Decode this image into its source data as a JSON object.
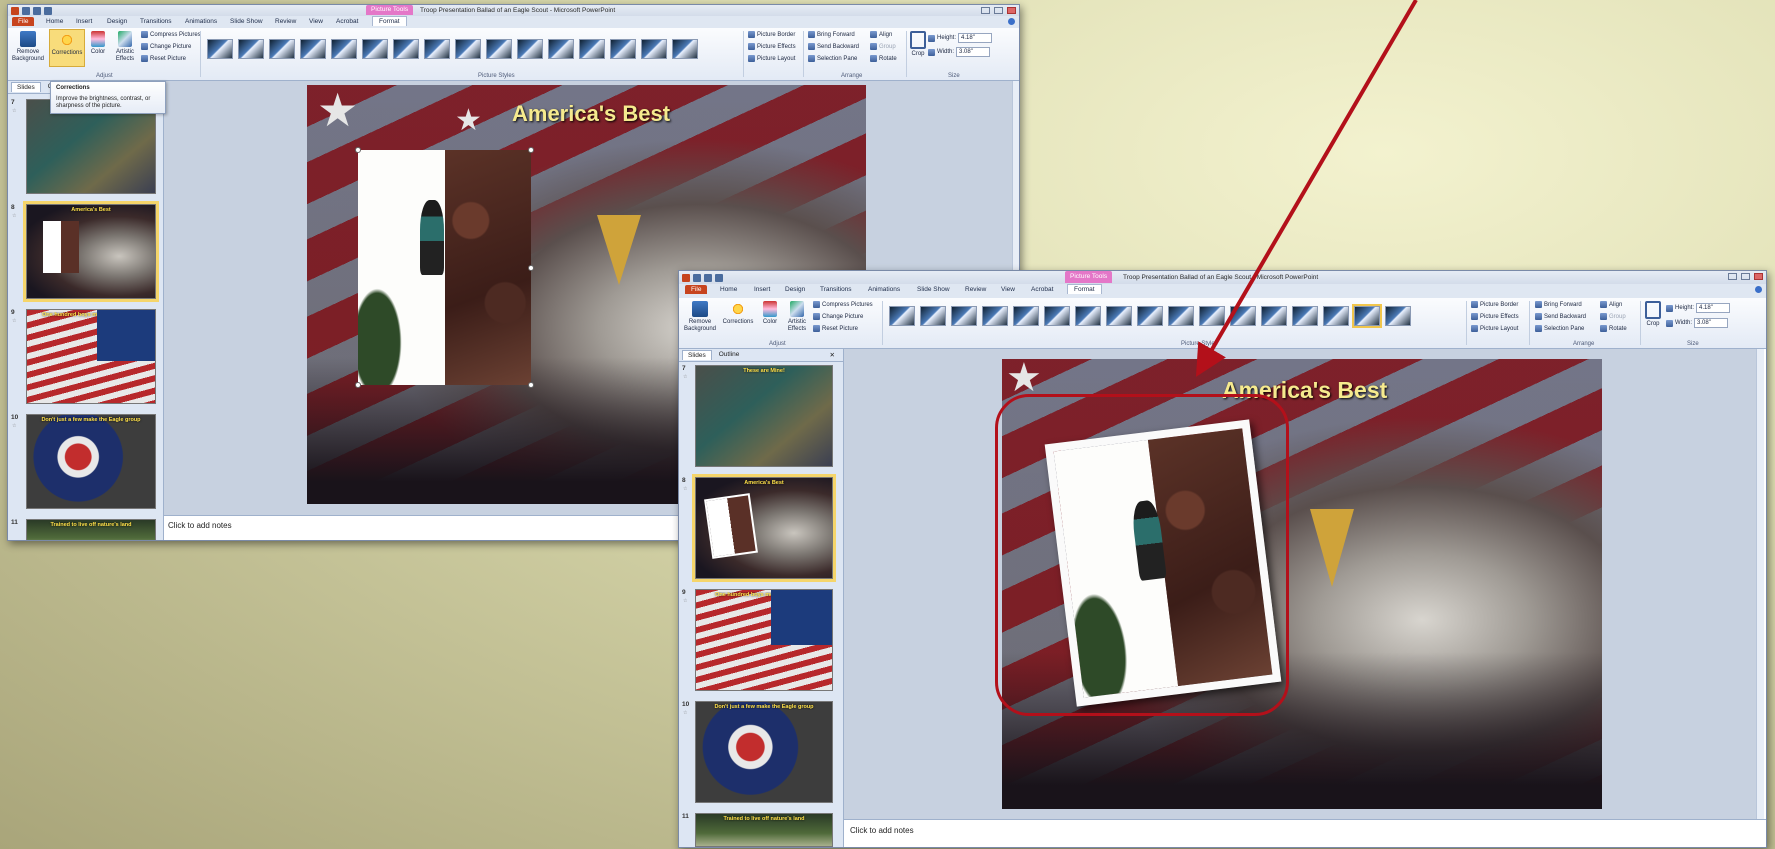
{
  "app": {
    "window_title": "Troop Presentation Ballad of an Eagle Scout - Microsoft PowerPoint",
    "context_tab": "Picture Tools"
  },
  "tabs": [
    "File",
    "Home",
    "Insert",
    "Design",
    "Transitions",
    "Animations",
    "Slide Show",
    "Review",
    "View",
    "Acrobat",
    "Format"
  ],
  "ribbon": {
    "adjust": {
      "remove_background": "Remove Background",
      "corrections": "Corrections",
      "color": "Color",
      "artistic_effects": "Artistic Effects",
      "compress": "Compress Pictures",
      "change": "Change Picture",
      "reset": "Reset Picture",
      "label": "Adjust"
    },
    "styles_label": "Picture Styles",
    "picture_border": "Picture Border",
    "picture_effects": "Picture Effects",
    "picture_layout": "Picture Layout",
    "arrange": {
      "bring_forward": "Bring Forward",
      "send_backward": "Send Backward",
      "selection_pane": "Selection Pane",
      "align": "Align",
      "group": "Group",
      "rotate": "Rotate",
      "label": "Arrange"
    },
    "size": {
      "crop": "Crop",
      "height_label": "Height:",
      "height_value": "4.18\"",
      "width_label": "Width:",
      "width_value": "3.08\"",
      "label": "Size"
    }
  },
  "pane": {
    "tab_slides": "Slides",
    "tab_outline": "Outline",
    "slides": [
      {
        "num": "7",
        "title": "These are Mine!"
      },
      {
        "num": "8",
        "title": "America's Best"
      },
      {
        "num": "9",
        "title": "One hundred boys may join the troop"
      },
      {
        "num": "10",
        "title": "Don't just a few make the Eagle group"
      },
      {
        "num": "11",
        "title": "Trained to live off nature's land"
      }
    ]
  },
  "slide": {
    "title": "America's Best"
  },
  "notes_placeholder": "Click to add notes",
  "tooltip_corrections": {
    "title": "Corrections",
    "body": "Improve the brightness, contrast, or sharpness of the picture."
  },
  "tooltip_style": "Rotated, White",
  "colors": {
    "file_tab": "#c7441e",
    "context_tab": "#e477c8",
    "annotation": "#b3101a",
    "slide_title": "#f6ea8e"
  }
}
